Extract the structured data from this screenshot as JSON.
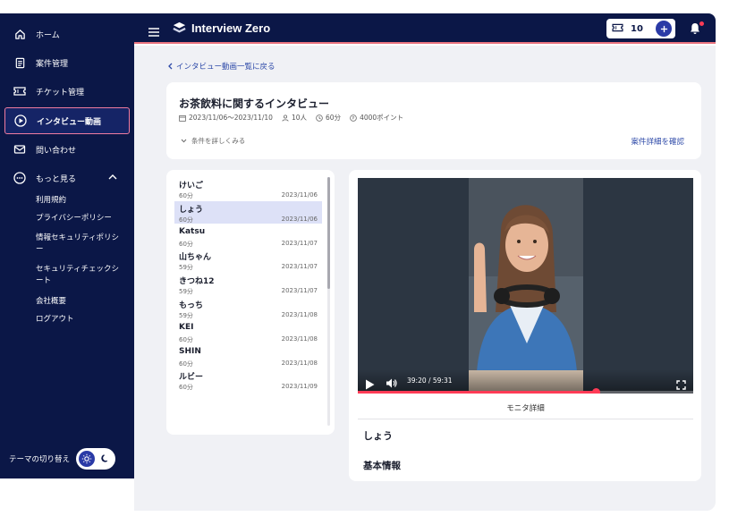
{
  "sidebar": {
    "items": [
      {
        "label": "ホーム",
        "icon": "home-icon"
      },
      {
        "label": "案件管理",
        "icon": "document-icon"
      },
      {
        "label": "チケット管理",
        "icon": "ticket-icon"
      },
      {
        "label": "インタビュー動画",
        "icon": "play-circle-icon"
      },
      {
        "label": "問い合わせ",
        "icon": "mail-icon"
      },
      {
        "label": "もっと見る",
        "icon": "more-icon"
      }
    ],
    "more_items": [
      "利用規約",
      "プライバシーポリシー",
      "情報セキュリティポリシー",
      "セキュリティチェックシート",
      "会社概要",
      "ログアウト"
    ],
    "theme_label": "テーマの切り替え",
    "active_index": 3
  },
  "header": {
    "brand": "Interview Zero",
    "ticket_count": "10"
  },
  "main": {
    "back_link": "インタビュー動画一覧に戻る",
    "project": {
      "title": "お茶飲料に関するインタビュー",
      "period": "2023/11/06〜2023/11/10",
      "people": "10人",
      "duration": "60分",
      "points": "4000ポイント",
      "expand_label": "条件を詳しくみる",
      "detail_link": "案件詳細を確認"
    },
    "interviews": [
      {
        "name": "けいご",
        "duration": "60分",
        "date": "2023/11/06"
      },
      {
        "name": "しょう",
        "duration": "60分",
        "date": "2023/11/06"
      },
      {
        "name": "Katsu",
        "duration": "60分",
        "date": "2023/11/07"
      },
      {
        "name": "山ちゃん",
        "duration": "59分",
        "date": "2023/11/07"
      },
      {
        "name": "きつね12",
        "duration": "59分",
        "date": "2023/11/07"
      },
      {
        "name": "もっち",
        "duration": "59分",
        "date": "2023/11/08"
      },
      {
        "name": "KEI",
        "duration": "60分",
        "date": "2023/11/08"
      },
      {
        "name": "SHIN",
        "duration": "60分",
        "date": "2023/11/08"
      },
      {
        "name": "ルビー",
        "duration": "60分",
        "date": "2023/11/09"
      }
    ],
    "selected_index": 1,
    "player": {
      "time": "39:20 / 59:31",
      "progress": 0.71
    },
    "monitor_tab": "モニタ詳細",
    "monitor_name": "しょう",
    "basic_info": "基本情報"
  },
  "colors": {
    "navy": "#0b1747",
    "accent": "#2d49a8",
    "active_border": "#f07ba0",
    "video_progress": "#ff3b56"
  }
}
